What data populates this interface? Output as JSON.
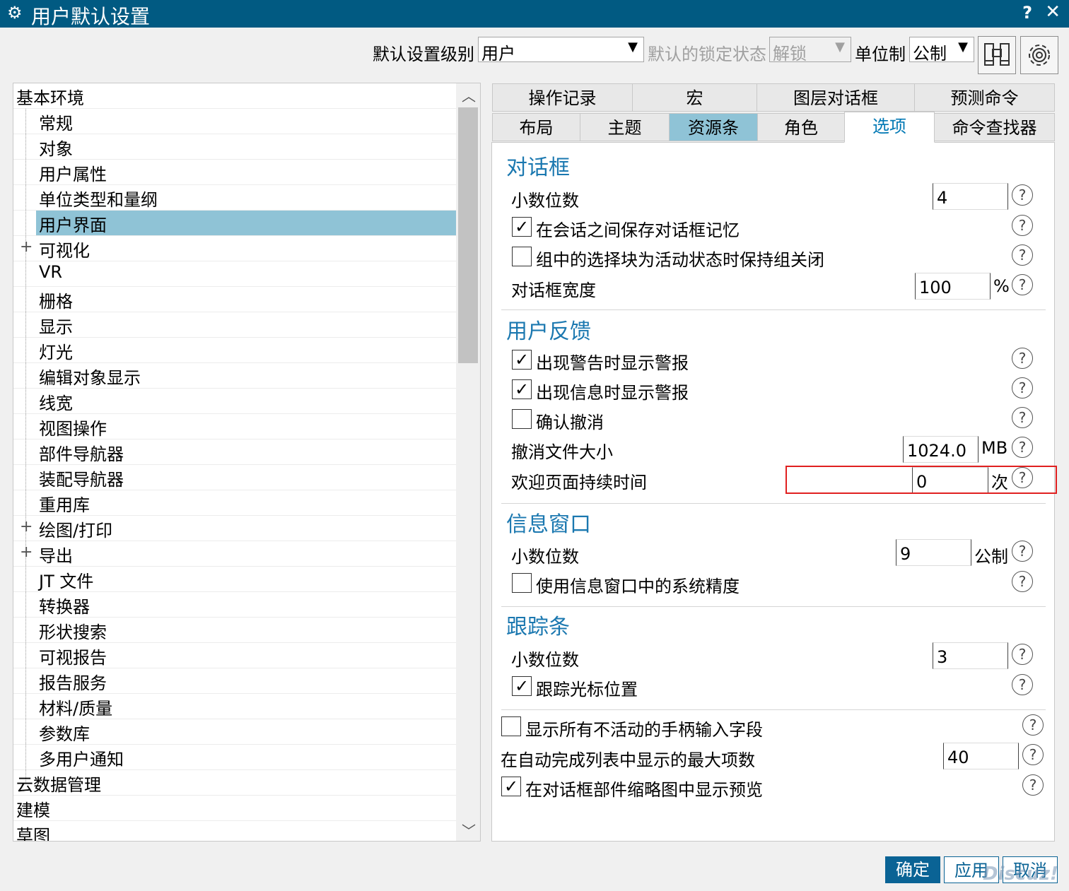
{
  "window": {
    "title": "用户默认设置",
    "help": "?",
    "close": "✕"
  },
  "toolbar": {
    "level_label": "默认设置级别",
    "level_value": "用户",
    "lock_label": "默认的锁定状态",
    "lock_value": "解锁",
    "unit_label": "单位制",
    "unit_value": "公制"
  },
  "tree": {
    "items": [
      {
        "label": "基本环境"
      },
      {
        "label": "常规"
      },
      {
        "label": "对象"
      },
      {
        "label": "用户属性"
      },
      {
        "label": "单位类型和量纲"
      },
      {
        "label": "用户界面"
      },
      {
        "label": "可视化"
      },
      {
        "label": "VR"
      },
      {
        "label": "栅格"
      },
      {
        "label": "显示"
      },
      {
        "label": "灯光"
      },
      {
        "label": "编辑对象显示"
      },
      {
        "label": "线宽"
      },
      {
        "label": "视图操作"
      },
      {
        "label": "部件导航器"
      },
      {
        "label": "装配导航器"
      },
      {
        "label": "重用库"
      },
      {
        "label": "绘图/打印"
      },
      {
        "label": "导出"
      },
      {
        "label": "JT 文件"
      },
      {
        "label": "转换器"
      },
      {
        "label": "形状搜索"
      },
      {
        "label": "可视报告"
      },
      {
        "label": "报告服务"
      },
      {
        "label": "材料/质量"
      },
      {
        "label": "参数库"
      },
      {
        "label": "多用户通知"
      },
      {
        "label": "云数据管理"
      },
      {
        "label": "建模"
      },
      {
        "label": "草图"
      }
    ],
    "selected": "用户界面"
  },
  "tabs": {
    "row1": [
      "操作记录",
      "宏",
      "图层对话框",
      "预测命令"
    ],
    "row2": [
      "布局",
      "主题",
      "资源条",
      "角色",
      "选项",
      "命令查找器"
    ],
    "active": "选项"
  },
  "dialog": {
    "title": "对话框",
    "decimals_label": "小数位数",
    "decimals_value": "4",
    "save_memory_label": "在会话之间保存对话框记忆",
    "save_memory_checked": true,
    "keep_closed_label": "组中的选择块为活动状态时保持组关闭",
    "keep_closed_checked": false,
    "width_label": "对话框宽度",
    "width_value": "100",
    "width_unit": "%"
  },
  "feedback": {
    "title": "用户反馈",
    "warn_label": "出现警告时显示警报",
    "warn_checked": true,
    "info_label": "出现信息时显示警报",
    "info_checked": true,
    "undo_confirm_label": "确认撤消",
    "undo_confirm_checked": false,
    "undo_size_label": "撤消文件大小",
    "undo_size_value": "1024.0",
    "undo_size_unit": "MB",
    "welcome_label": "欢迎页面持续时间",
    "welcome_value": "0",
    "welcome_unit": "次"
  },
  "info_window": {
    "title": "信息窗口",
    "decimals_label": "小数位数",
    "decimals_value": "9",
    "decimals_unit": "公制",
    "system_precision_label": "使用信息窗口中的系统精度",
    "system_precision_checked": false
  },
  "tracking": {
    "title": "跟踪条",
    "decimals_label": "小数位数",
    "decimals_value": "3",
    "cursor_label": "跟踪光标位置",
    "cursor_checked": true
  },
  "misc": {
    "inactive_handles_label": "显示所有不活动的手柄输入字段",
    "inactive_handles_checked": false,
    "autocomplete_label": "在自动完成列表中显示的最大项数",
    "autocomplete_value": "40",
    "preview_label": "在对话框部件缩略图中显示预览",
    "preview_checked": true
  },
  "buttons": {
    "ok": "确定",
    "apply": "应用",
    "cancel": "取消"
  },
  "watermark": "Discuz!",
  "help_glyph": "?",
  "check_glyph": "✓",
  "icons": {
    "title": "gear-icon",
    "find": "binoculars-icon",
    "settings": "settings-gear-icon"
  }
}
